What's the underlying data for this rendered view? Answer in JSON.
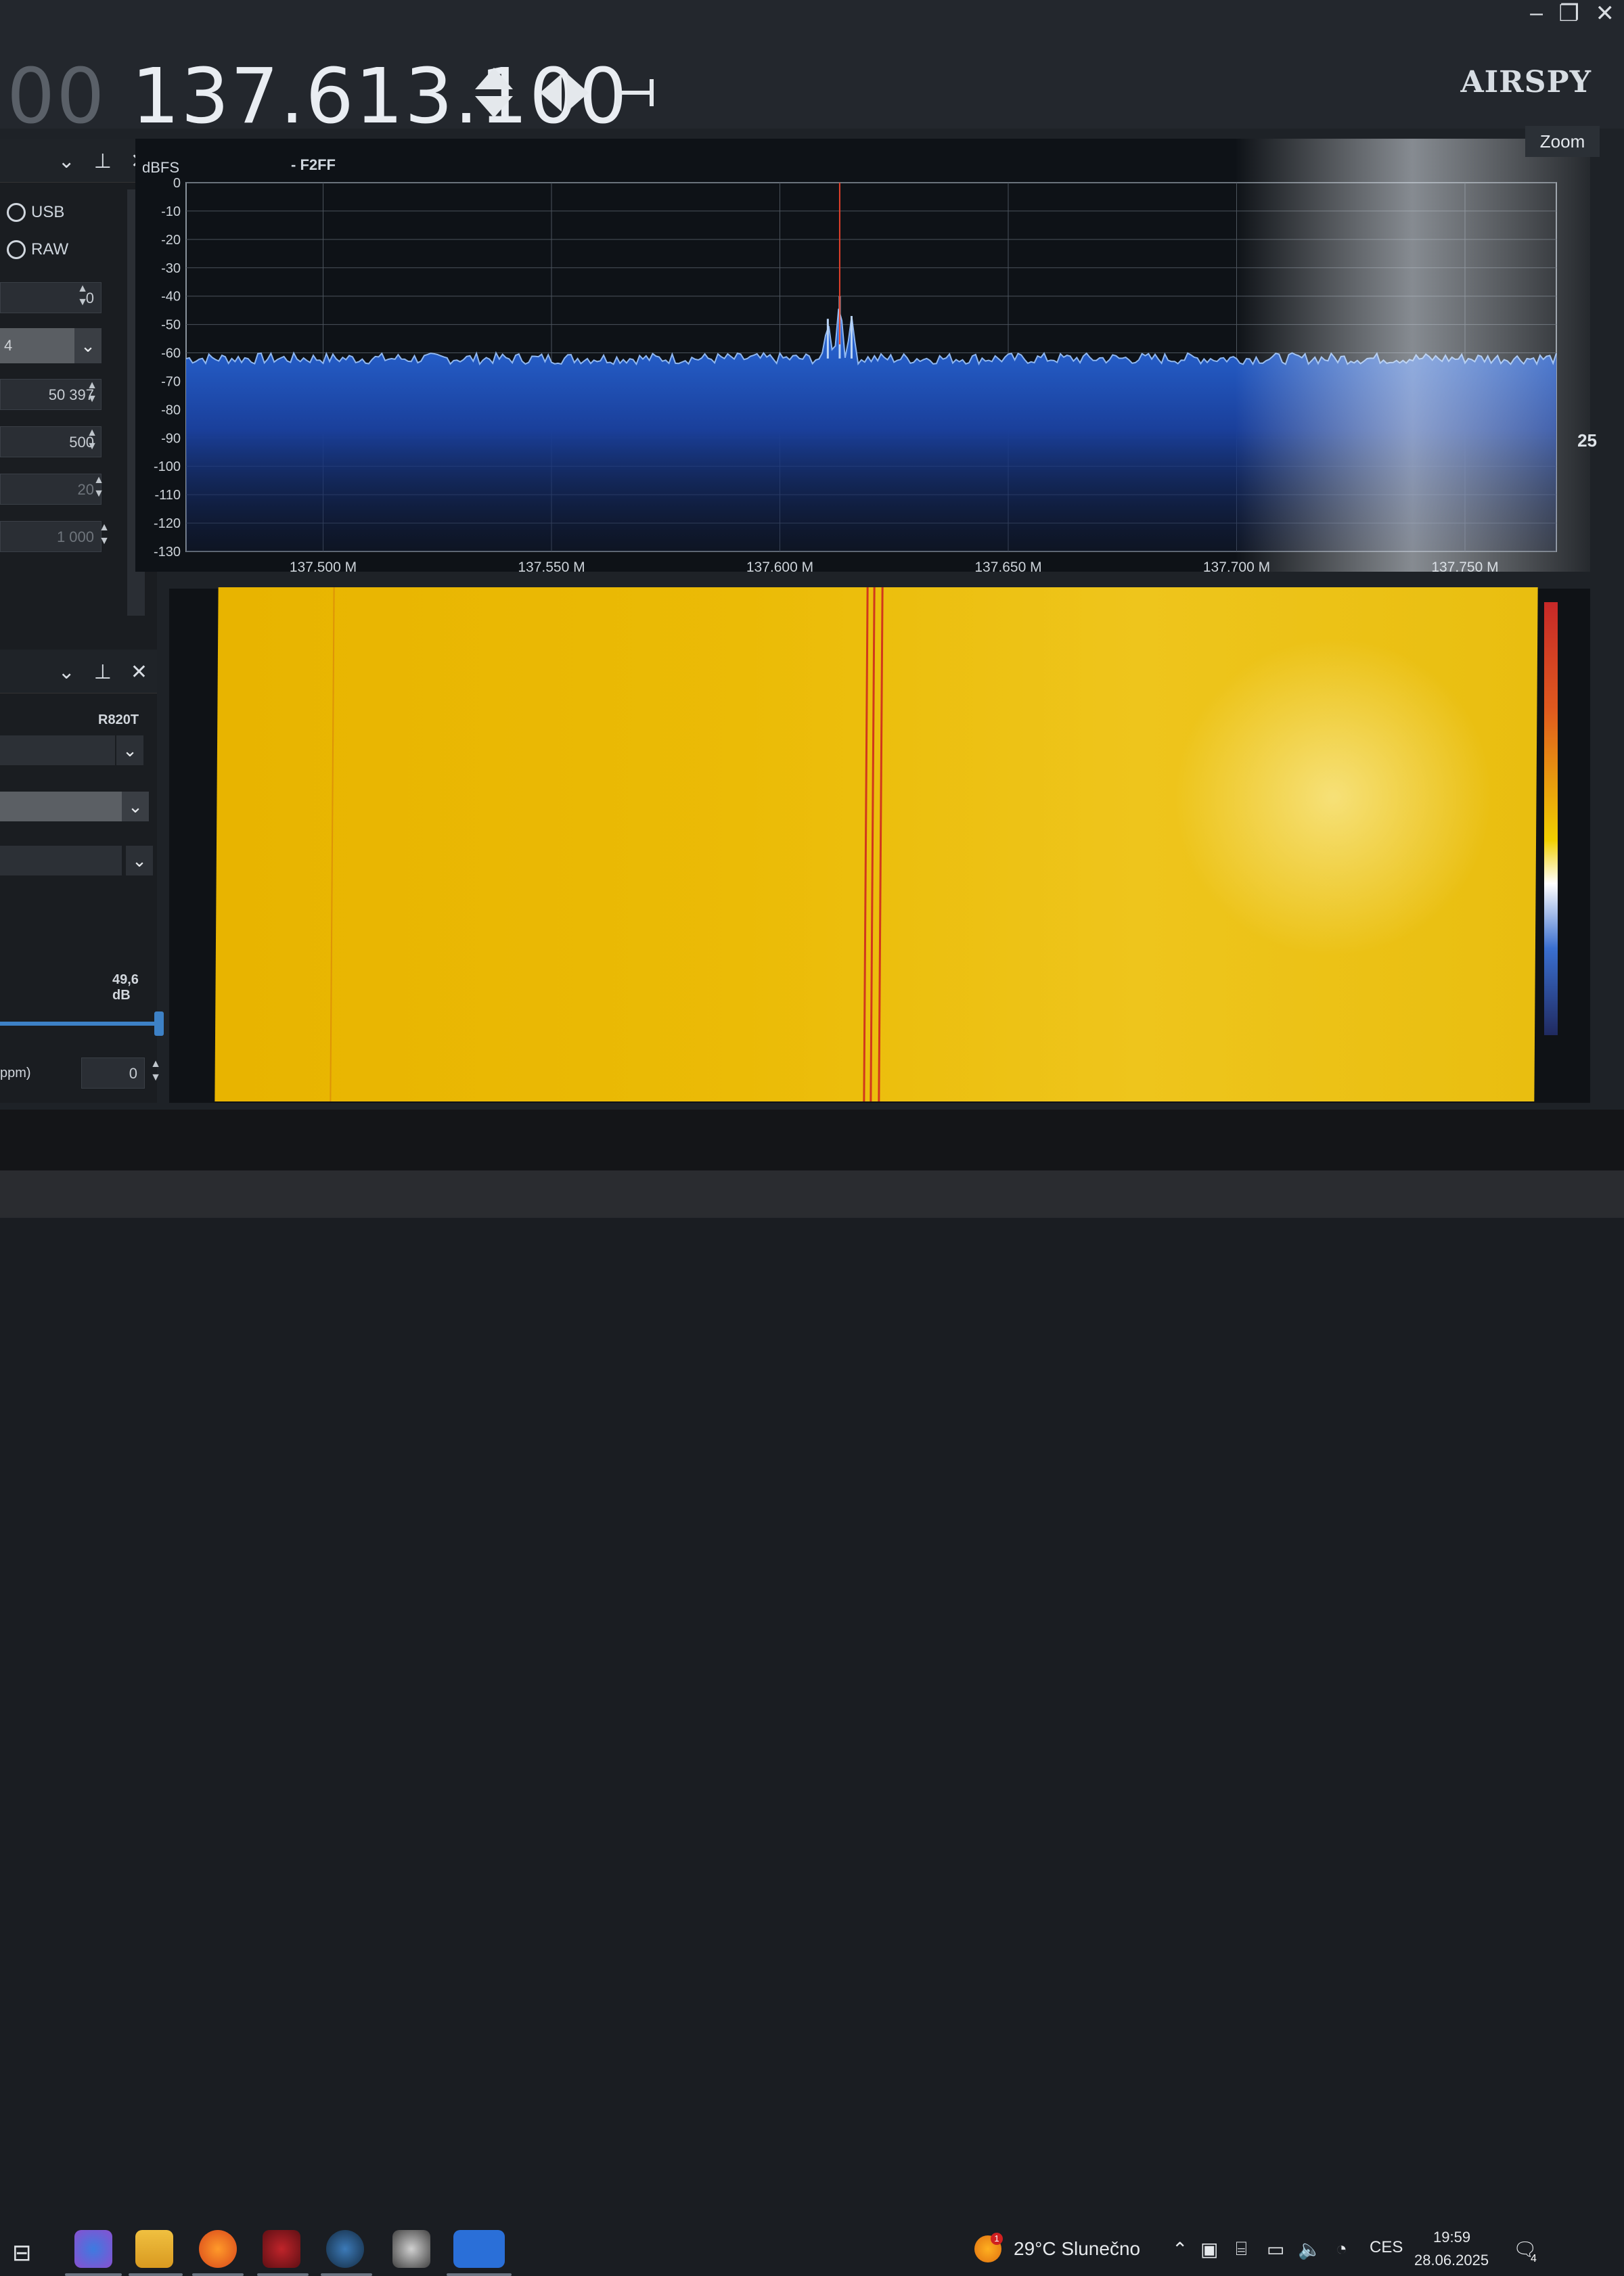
{
  "header": {
    "freq_prefix": "00",
    "frequency": "137.613.100",
    "logo": "AIRSPY",
    "zoom_label": "Zoom"
  },
  "window_controls": {
    "minimize": "–",
    "restore": "❐",
    "close": "✕"
  },
  "left_panel": {
    "modes": [
      "USB",
      "RAW"
    ],
    "spin_values": [
      "0",
      "50 397",
      "500",
      "20",
      "1 000"
    ],
    "device_label": "R820T",
    "gain_label": "49,6 dB",
    "ppm_label": "ppm)",
    "ppm_value": "0",
    "select_value": "4"
  },
  "spectrum": {
    "unit_label": "dBFS",
    "marker_label": "- F2FF",
    "side_value": "25"
  },
  "chart_data": {
    "type": "line",
    "xlabel": "",
    "ylabel": "dBFS",
    "x_ticks": [
      "137,500 M",
      "137,550 M",
      "137,600 M",
      "137,650 M",
      "137,700 M",
      "137,750 M"
    ],
    "y_ticks": [
      "0",
      "-10",
      "-20",
      "-30",
      "-40",
      "-50",
      "-60",
      "-70",
      "-80",
      "-90",
      "-100",
      "-110",
      "-120",
      "-130"
    ],
    "ylim": [
      -130,
      0
    ],
    "xlim": [
      137.47,
      137.77
    ],
    "noise_floor": -62,
    "tuned_frequency": 137.6131,
    "peaks": [
      {
        "x": 137.6105,
        "y": -48
      },
      {
        "x": 137.6131,
        "y": -40
      },
      {
        "x": 137.6157,
        "y": -47
      }
    ],
    "grid": true
  },
  "taskbar": {
    "weather": "29°C  Slunečno",
    "lang": "CES",
    "time": "19:59",
    "date": "28.06.2025",
    "notif_count": "4",
    "weather_badge": "1"
  },
  "colors": {
    "waterfall": "#ebbb06",
    "signal_line": "#d1381c",
    "spectrum_fill": "#1f57c9",
    "accent": "#3d81c6"
  }
}
